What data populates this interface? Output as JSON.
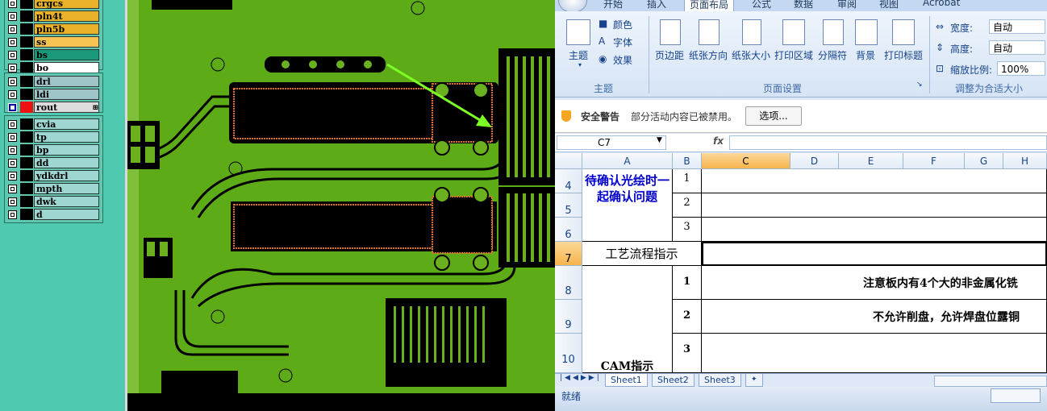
{
  "layers": {
    "group1": [
      {
        "name": "crgcs",
        "color": "#e8b22a"
      },
      {
        "name": "pln4t",
        "color": "#e8b22a"
      },
      {
        "name": "pln5b",
        "color": "#e8b22a"
      },
      {
        "name": "ss",
        "color": "#f6c454"
      },
      {
        "name": "bs",
        "color": "#1a9a7a"
      },
      {
        "name": "bo",
        "color": "#ffffff"
      }
    ],
    "group2": [
      {
        "name": "drl",
        "color": "#9ec4c8"
      },
      {
        "name": "ldi",
        "color": "#9ec4c8"
      },
      {
        "name": "rout",
        "color": "#dcdcdc",
        "active": true,
        "marker": "⊞"
      }
    ],
    "group3": [
      {
        "name": "cvia",
        "color": "#9ed6d2"
      },
      {
        "name": "tp",
        "color": "#9ed6d2"
      },
      {
        "name": "bp",
        "color": "#9ed6d2"
      },
      {
        "name": "dd",
        "color": "#9ed6d2"
      },
      {
        "name": "ydkdrl",
        "color": "#9ed6d2"
      },
      {
        "name": "mpth",
        "color": "#9ed6d2"
      },
      {
        "name": "dwk",
        "color": "#9ed6d2"
      },
      {
        "name": "d",
        "color": "#9ed6d2"
      }
    ]
  },
  "excel": {
    "tabs": [
      "开始",
      "插入",
      "页面布局",
      "公式",
      "数据",
      "审阅",
      "视图",
      "Acrobat"
    ],
    "active_tab": "页面布局",
    "ribbon": {
      "theme_group": {
        "theme": "主题",
        "colors": "颜色",
        "fonts": "字体",
        "effects": "效果",
        "label": "主题"
      },
      "page_setup_group": {
        "buttons": [
          "页边距",
          "纸张方向",
          "纸张大小",
          "打印区域",
          "分隔符",
          "背景",
          "打印标题"
        ],
        "label": "页面设置"
      },
      "scale_group": {
        "width_label": "宽度:",
        "width_value": "自动",
        "height_label": "高度:",
        "height_value": "自动",
        "scale_label": "缩放比例:",
        "scale_value": "100%",
        "label": "调整为合适大小"
      }
    },
    "security": {
      "title": "安全警告",
      "message": "部分活动内容已被禁用。",
      "button": "选项..."
    },
    "name_box": "C7",
    "fx": "fx",
    "columns": [
      "A",
      "B",
      "C",
      "D",
      "E",
      "F",
      "G",
      "H"
    ],
    "selected_column": "C",
    "rows": [
      "4",
      "5",
      "6",
      "7",
      "8",
      "9",
      "10"
    ],
    "selected_row": "7",
    "cells": {
      "a4": "待确认光绘时一起确认问题",
      "b4": "1",
      "b5": "2",
      "b6": "3",
      "a7": "工艺流程指示",
      "b8": "1",
      "b9": "2",
      "b10": "3",
      "c8": "注意板内有4个大的非金属化铣",
      "c9": "不允许削盘，允许焊盘位露铜",
      "a_cam": "CAM指示"
    },
    "sheets": [
      "Sheet1",
      "Sheet2",
      "Sheet3"
    ],
    "active_sheet": "Sheet1",
    "status": "就绪"
  }
}
